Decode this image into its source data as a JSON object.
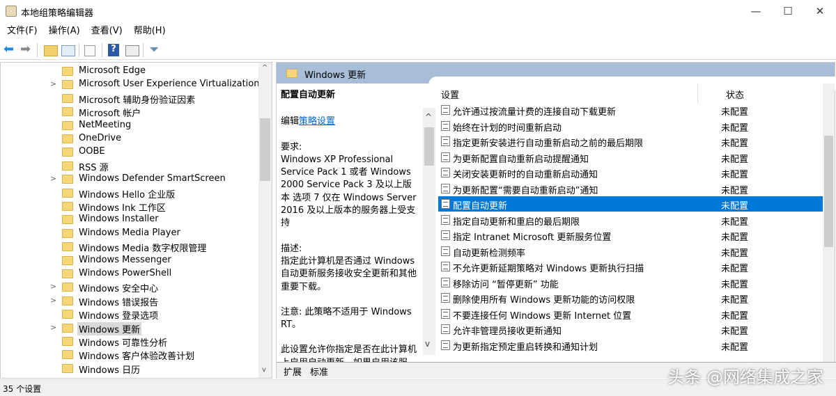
{
  "window": {
    "title": "本地组策略编辑器",
    "controls": [
      "—",
      "☐",
      "✕"
    ]
  },
  "menu": [
    "文件(F)",
    "操作(A)",
    "查看(V)",
    "帮助(H)"
  ],
  "tree": [
    {
      "label": "Microsoft Edge",
      "exp": false
    },
    {
      "label": "Microsoft User Experience Virtualization",
      "exp": true
    },
    {
      "label": "Microsoft 辅助身份验证因素",
      "exp": false
    },
    {
      "label": "Microsoft 帐户",
      "exp": false
    },
    {
      "label": "NetMeeting",
      "exp": false
    },
    {
      "label": "OneDrive",
      "exp": false
    },
    {
      "label": "OOBE",
      "exp": false
    },
    {
      "label": "RSS 源",
      "exp": false
    },
    {
      "label": "Windows Defender SmartScreen",
      "exp": true
    },
    {
      "label": "Windows Hello 企业版",
      "exp": false
    },
    {
      "label": "Windows Ink 工作区",
      "exp": false
    },
    {
      "label": "Windows Installer",
      "exp": false
    },
    {
      "label": "Windows Media Player",
      "exp": false
    },
    {
      "label": "Windows Media 数字权限管理",
      "exp": false
    },
    {
      "label": "Windows Messenger",
      "exp": false
    },
    {
      "label": "Windows PowerShell",
      "exp": false
    },
    {
      "label": "Windows 安全中心",
      "exp": true
    },
    {
      "label": "Windows 错误报告",
      "exp": true
    },
    {
      "label": "Windows 登录选项",
      "exp": false
    },
    {
      "label": "Windows 更新",
      "exp": true,
      "selected": true
    },
    {
      "label": "Windows 可靠性分析",
      "exp": false
    },
    {
      "label": "Windows 客户体验改善计划",
      "exp": false
    },
    {
      "label": "Windows 日历",
      "exp": false
    }
  ],
  "right": {
    "header": "Windows 更新",
    "desc": {
      "title": "配置自动更新",
      "edit_prefix": "编辑",
      "edit_link": "策略设置",
      "req_label": "要求:",
      "req": "Windows XP Professional Service Pack 1 或者 Windows 2000 Service Pack 3 及以上版本 选项 7 仅在 Windows Server 2016 及以上版本的服务器上受支持",
      "desc_label": "描述:",
      "desc": "指定此计算机是否通过 Windows 自动更新服务接收安全更新和其他重要下载。",
      "note": "注意: 此策略不适用于 Windows RT。",
      "more": "此设置允许你指定是否在此计算机上启用自动更新。如果启用该服"
    },
    "col_setting": "设置",
    "col_state": "状态",
    "rows": [
      {
        "name": "允许通过按流量计费的连接自动下载更新",
        "state": "未配置"
      },
      {
        "name": "始终在计划的时间重新启动",
        "state": "未配置"
      },
      {
        "name": "指定更新安装进行自动重新启动之前的最后期限",
        "state": "未配置"
      },
      {
        "name": "为更新配置自动重新启动提醒通知",
        "state": "未配置"
      },
      {
        "name": "关闭安装更新时的自动重新启动通知",
        "state": "未配置"
      },
      {
        "name": "为更新配置“需要自动重新启动”通知",
        "state": "未配置"
      },
      {
        "name": "配置自动更新",
        "state": "未配置",
        "selected": true
      },
      {
        "name": "指定自动更新和重启的最后期限",
        "state": "未配置"
      },
      {
        "name": "指定 Intranet Microsoft 更新服务位置",
        "state": "未配置"
      },
      {
        "name": "自动更新检测频率",
        "state": "未配置"
      },
      {
        "name": "不允许更新延期策略对 Windows 更新执行扫描",
        "state": "未配置"
      },
      {
        "name": "移除访问 “暂停更新” 功能",
        "state": "未配置"
      },
      {
        "name": "删除使用所有 Windows 更新功能的访问权限",
        "state": "未配置"
      },
      {
        "name": "不要连接任何 Windows 更新 Internet 位置",
        "state": "未配置"
      },
      {
        "name": "允许非管理员接收更新通知",
        "state": "未配置"
      },
      {
        "name": "为更新指定预定重启转换和通知计划",
        "state": "未配置"
      }
    ],
    "tabs": [
      "扩展",
      "标准"
    ]
  },
  "status": "35 个设置",
  "watermark": "头条 @网络集成之家"
}
